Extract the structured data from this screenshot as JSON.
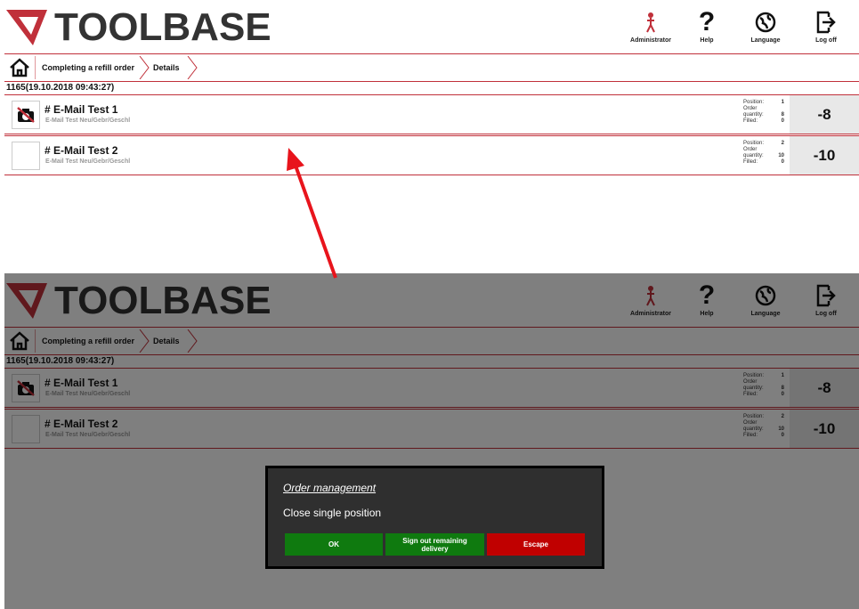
{
  "app": {
    "logo_text": "TOOLBASE",
    "header_buttons": [
      {
        "name": "administrator",
        "label": "Administrator",
        "icon": "user-figure-icon"
      },
      {
        "name": "help",
        "label": "Help",
        "icon": "question-icon"
      },
      {
        "name": "language",
        "label": "Language",
        "icon": "globe-icon"
      },
      {
        "name": "logoff",
        "label": "Log off",
        "icon": "logout-icon"
      }
    ],
    "breadcrumb": [
      "Completing a refill order",
      "Details"
    ],
    "order_header": "1165(19.10.2018 09:43:27)",
    "colors": {
      "accent_red": "#c0303a",
      "ok_green": "#0f7a0f",
      "escape_red": "#c00000"
    }
  },
  "items": [
    {
      "title": "# E-Mail Test 1",
      "subtitle": "E-Mail Test Neu/Gebr/Geschl",
      "position_label": "Position:",
      "position": "1",
      "order_qty_label": "Order quantity:",
      "order_qty": "8",
      "filled_label": "Filled:",
      "filled": "0",
      "qty": "-8",
      "icon": "no-camera-icon"
    },
    {
      "title": "# E-Mail Test 2",
      "subtitle": "E-Mail Test Neu/Gebr/Geschl",
      "position_label": "Position:",
      "position": "2",
      "order_qty_label": "Order quantity:",
      "order_qty": "10",
      "filled_label": "Filled:",
      "filled": "0",
      "qty": "-10",
      "icon": ""
    }
  ],
  "dialog": {
    "title": "Order management",
    "message": "Close single position",
    "buttons": {
      "ok": "OK",
      "sign_out": "Sign out remaining delivery",
      "escape": "Escape"
    }
  }
}
